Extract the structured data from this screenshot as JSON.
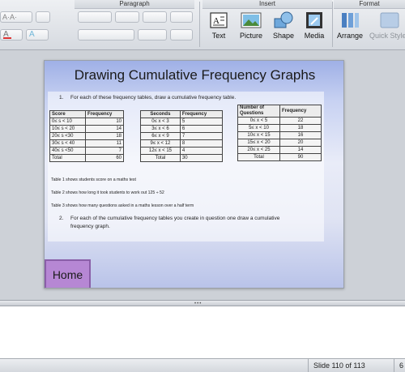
{
  "ribbon": {
    "groups": {
      "paragraph": "Paragraph",
      "insert": "Insert",
      "format": "Format"
    },
    "buttons": {
      "text": "Text",
      "picture": "Picture",
      "shape": "Shape",
      "media": "Media",
      "arrange": "Arrange",
      "quick_styles": "Quick Styles"
    }
  },
  "slide": {
    "title": "Drawing Cumulative Frequency Graphs",
    "q1_num": "1.",
    "q1_text": "For each of these frequency tables, draw a cumulative frequency table.",
    "table1": {
      "headers": [
        "Score",
        "Frequency"
      ],
      "rows": [
        [
          "0≤ s < 10",
          "10"
        ],
        [
          "10≤ s < 20",
          "14"
        ],
        [
          "20≤ s <30",
          "18"
        ],
        [
          "30≤ s < 40",
          "11"
        ],
        [
          "40≤ s <50",
          "7"
        ],
        [
          "Total",
          "60"
        ]
      ]
    },
    "table2": {
      "headers": [
        "Seconds",
        "Frequency"
      ],
      "rows": [
        [
          "0≤ x < 3",
          "5"
        ],
        [
          "3≤ x < 6",
          "6"
        ],
        [
          "6≤ x < 9",
          "7"
        ],
        [
          "9≤ x < 12",
          "8"
        ],
        [
          "12≤ x < 15",
          "4"
        ],
        [
          "Total",
          "30"
        ]
      ]
    },
    "table3": {
      "headers": [
        "Number of Questions",
        "Frequency"
      ],
      "rows": [
        [
          "0≤ x < 5",
          "22"
        ],
        [
          "5≤ x < 10",
          "18"
        ],
        [
          "10≤ x < 15",
          "16"
        ],
        [
          "15≤ x < 20",
          "20"
        ],
        [
          "20≤ x < 25",
          "14"
        ],
        [
          "Total",
          "90"
        ]
      ]
    },
    "notes": [
      "Table 1 shows students  score on a maths test",
      "Table 2 shows how long it took students to work out 125 ÷ 52",
      "Table 3 shows how many questions asked in a maths lesson over a half term"
    ],
    "q2_num": "2.",
    "q2_text_line1": "For each of the cumulative frequency tables you create in question one draw a cumulative",
    "q2_text_line2": "frequency graph.",
    "home_label": "Home"
  },
  "status": {
    "slide_indicator": "Slide 110 of 113",
    "zoom_partial": "6"
  },
  "icons": [
    "text-box-icon",
    "picture-icon",
    "shape-icon",
    "media-icon",
    "arrange-icon",
    "quick-styles-icon"
  ],
  "colors": {
    "home_button": "#b687d4",
    "slide_gradient_top": "#9fb0e6"
  }
}
